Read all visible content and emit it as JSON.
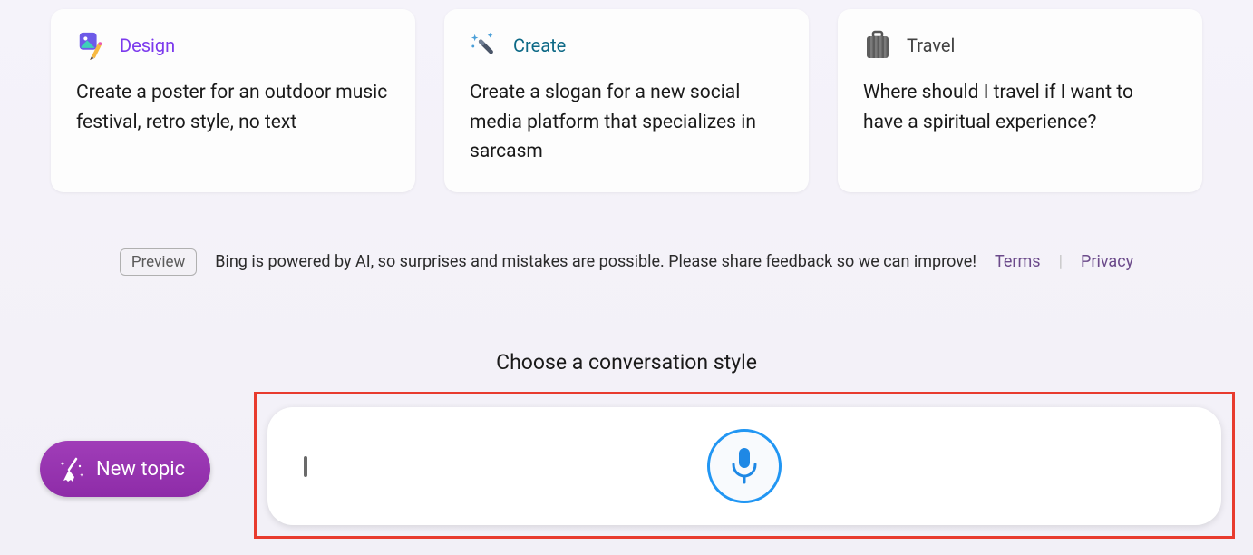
{
  "cards": [
    {
      "title": "Design",
      "text": "Create a poster for an outdoor music festival, retro style, no text",
      "icon": "design-icon"
    },
    {
      "title": "Create",
      "text": "Create a slogan for a new social media platform that specializes in sarcasm",
      "icon": "wand-icon"
    },
    {
      "title": "Travel",
      "text": "Where should I travel if I want to have a spiritual experience?",
      "icon": "suitcase-icon"
    }
  ],
  "disclaimer": {
    "badge": "Preview",
    "text": "Bing is powered by AI, so surprises and mistakes are possible. Please share feedback so we can improve!",
    "terms": "Terms",
    "privacy": "Privacy"
  },
  "styleHeading": "Choose a conversation style",
  "newTopic": "New topic",
  "colors": {
    "accentPurple": "#8e2ca8",
    "highlightRed": "#e83b2e",
    "micBlue": "#2196f3"
  }
}
